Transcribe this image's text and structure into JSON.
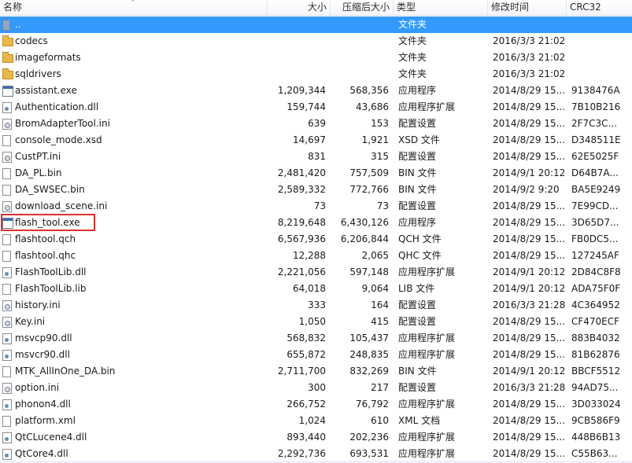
{
  "columns": {
    "name": "名称",
    "size": "大小",
    "compressed": "压缩后大小",
    "type": "类型",
    "modified": "修改时间",
    "crc": "CRC32"
  },
  "rows": [
    {
      "name": "..",
      "size": "",
      "compressed": "",
      "type": "文件夹",
      "modified": "",
      "crc": "",
      "icon": "parent-folder-icon"
    },
    {
      "name": "codecs",
      "size": "",
      "compressed": "",
      "type": "文件夹",
      "modified": "2016/3/3 21:02",
      "crc": "",
      "icon": "folder-icon"
    },
    {
      "name": "imageformats",
      "size": "",
      "compressed": "",
      "type": "文件夹",
      "modified": "2016/3/3 21:02",
      "crc": "",
      "icon": "folder-icon"
    },
    {
      "name": "sqldrivers",
      "size": "",
      "compressed": "",
      "type": "文件夹",
      "modified": "2016/3/3 21:02",
      "crc": "",
      "icon": "folder-icon"
    },
    {
      "name": "assistant.exe",
      "size": "1,209,344",
      "compressed": "568,356",
      "type": "应用程序",
      "modified": "2014/8/29 15...",
      "crc": "9138476A",
      "icon": "exe-icon"
    },
    {
      "name": "Authentication.dll",
      "size": "159,744",
      "compressed": "43,686",
      "type": "应用程序扩展",
      "modified": "2014/8/29 15...",
      "crc": "7B10B216",
      "icon": "dll-icon"
    },
    {
      "name": "BromAdapterTool.ini",
      "size": "639",
      "compressed": "153",
      "type": "配置设置",
      "modified": "2014/8/29 15...",
      "crc": "2F7C3C...",
      "icon": "config-icon"
    },
    {
      "name": "console_mode.xsd",
      "size": "14,697",
      "compressed": "1,921",
      "type": "XSD 文件",
      "modified": "2014/8/29 15...",
      "crc": "D348511E",
      "icon": "file-icon"
    },
    {
      "name": "CustPT.ini",
      "size": "831",
      "compressed": "315",
      "type": "配置设置",
      "modified": "2014/8/29 15...",
      "crc": "62E5025F",
      "icon": "config-icon"
    },
    {
      "name": "DA_PL.bin",
      "size": "2,481,420",
      "compressed": "757,509",
      "type": "BIN 文件",
      "modified": "2014/9/1 20:12",
      "crc": "D64B7A...",
      "icon": "file-icon"
    },
    {
      "name": "DA_SWSEC.bin",
      "size": "2,589,332",
      "compressed": "772,766",
      "type": "BIN 文件",
      "modified": "2014/9/2 9:20",
      "crc": "BA5E9249",
      "icon": "file-icon"
    },
    {
      "name": "download_scene.ini",
      "size": "73",
      "compressed": "73",
      "type": "配置设置",
      "modified": "2014/8/29 15...",
      "crc": "7E99CD...",
      "icon": "config-icon"
    },
    {
      "name": "flash_tool.exe",
      "size": "8,219,648",
      "compressed": "6,430,126",
      "type": "应用程序",
      "modified": "2014/8/29 15...",
      "crc": "3D65D7...",
      "icon": "exe-icon"
    },
    {
      "name": "flashtool.qch",
      "size": "6,567,936",
      "compressed": "6,206,844",
      "type": "QCH 文件",
      "modified": "2014/8/29 15...",
      "crc": "FB0DC5...",
      "icon": "file-icon"
    },
    {
      "name": "flashtool.qhc",
      "size": "12,288",
      "compressed": "2,065",
      "type": "QHC 文件",
      "modified": "2014/8/29 15...",
      "crc": "127245AF",
      "icon": "file-icon"
    },
    {
      "name": "FlashToolLib.dll",
      "size": "2,221,056",
      "compressed": "597,148",
      "type": "应用程序扩展",
      "modified": "2014/9/1 20:12",
      "crc": "2D84C8F8",
      "icon": "dll-icon"
    },
    {
      "name": "FlashToolLib.lib",
      "size": "64,018",
      "compressed": "9,064",
      "type": "LIB 文件",
      "modified": "2014/9/1 20:12",
      "crc": "ADA75F0F",
      "icon": "file-icon"
    },
    {
      "name": "history.ini",
      "size": "333",
      "compressed": "164",
      "type": "配置设置",
      "modified": "2016/3/3 21:28",
      "crc": "4C364952",
      "icon": "config-icon"
    },
    {
      "name": "Key.ini",
      "size": "1,050",
      "compressed": "415",
      "type": "配置设置",
      "modified": "2014/8/29 15...",
      "crc": "CF470ECF",
      "icon": "config-icon"
    },
    {
      "name": "msvcp90.dll",
      "size": "568,832",
      "compressed": "105,437",
      "type": "应用程序扩展",
      "modified": "2014/8/29 15...",
      "crc": "883B4032",
      "icon": "dll-icon"
    },
    {
      "name": "msvcr90.dll",
      "size": "655,872",
      "compressed": "248,835",
      "type": "应用程序扩展",
      "modified": "2014/8/29 15...",
      "crc": "81B62876",
      "icon": "dll-icon"
    },
    {
      "name": "MTK_AllInOne_DA.bin",
      "size": "2,711,700",
      "compressed": "832,269",
      "type": "BIN 文件",
      "modified": "2014/9/1 20:12",
      "crc": "BBCF5512",
      "icon": "file-icon"
    },
    {
      "name": "option.ini",
      "size": "300",
      "compressed": "217",
      "type": "配置设置",
      "modified": "2016/3/3 21:28",
      "crc": "94AD75...",
      "icon": "config-icon"
    },
    {
      "name": "phonon4.dll",
      "size": "266,752",
      "compressed": "76,792",
      "type": "应用程序扩展",
      "modified": "2014/8/29 15...",
      "crc": "3D033024",
      "icon": "dll-icon"
    },
    {
      "name": "platform.xml",
      "size": "1,024",
      "compressed": "610",
      "type": "XML 文档",
      "modified": "2014/8/29 15...",
      "crc": "9CB586F9",
      "icon": "file-icon"
    },
    {
      "name": "QtCLucene4.dll",
      "size": "893,440",
      "compressed": "202,236",
      "type": "应用程序扩展",
      "modified": "2014/8/29 15...",
      "crc": "448B6B13",
      "icon": "dll-icon"
    },
    {
      "name": "QtCore4.dll",
      "size": "2,292,736",
      "compressed": "693,531",
      "type": "应用程序扩展",
      "modified": "2014/8/29 15...",
      "crc": "C55B63...",
      "icon": "dll-icon"
    }
  ]
}
